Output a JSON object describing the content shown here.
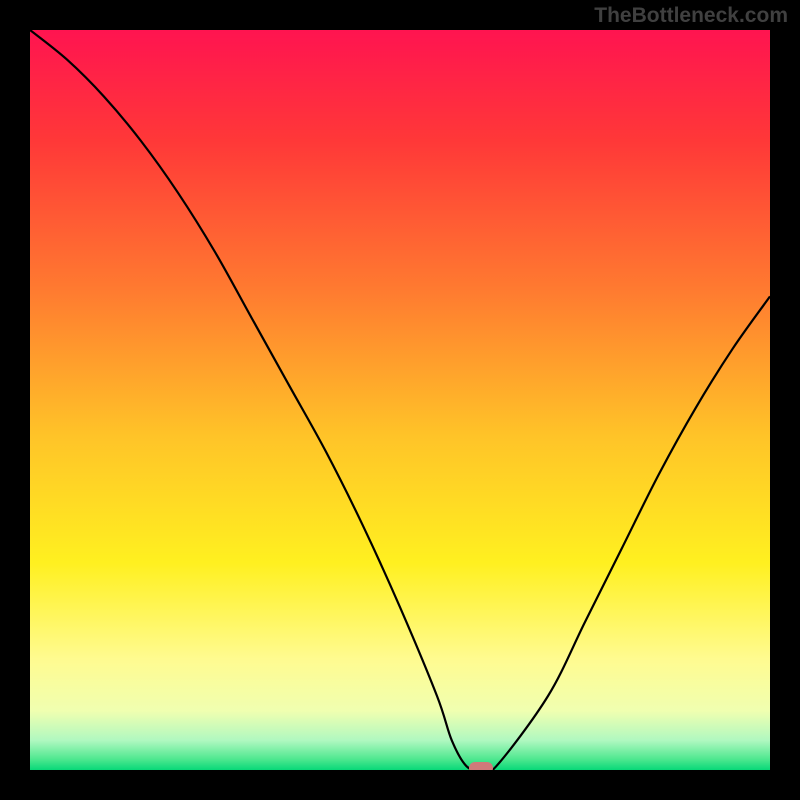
{
  "watermark": "TheBottleneck.com",
  "chart_data": {
    "type": "line",
    "title": "",
    "xlabel": "",
    "ylabel": "",
    "xlim": [
      0,
      100
    ],
    "ylim": [
      0,
      100
    ],
    "x": [
      0,
      5,
      10,
      15,
      20,
      25,
      30,
      35,
      40,
      45,
      50,
      55,
      57,
      59,
      61,
      63,
      70,
      75,
      80,
      85,
      90,
      95,
      100
    ],
    "values": [
      100,
      96,
      91,
      85,
      78,
      70,
      61,
      52,
      43,
      33,
      22,
      10,
      4,
      0.5,
      0,
      0.5,
      10,
      20,
      30,
      40,
      49,
      57,
      64
    ],
    "marker": {
      "x": 61,
      "y": 0
    },
    "gradient_stops": [
      {
        "pos": 0.0,
        "color": "#ff1450"
      },
      {
        "pos": 0.15,
        "color": "#ff3838"
      },
      {
        "pos": 0.35,
        "color": "#ff7a30"
      },
      {
        "pos": 0.55,
        "color": "#ffc428"
      },
      {
        "pos": 0.72,
        "color": "#fff020"
      },
      {
        "pos": 0.85,
        "color": "#fffb90"
      },
      {
        "pos": 0.92,
        "color": "#f0ffb0"
      },
      {
        "pos": 0.96,
        "color": "#b0f8c0"
      },
      {
        "pos": 0.985,
        "color": "#50e890"
      },
      {
        "pos": 1.0,
        "color": "#08d878"
      }
    ]
  }
}
